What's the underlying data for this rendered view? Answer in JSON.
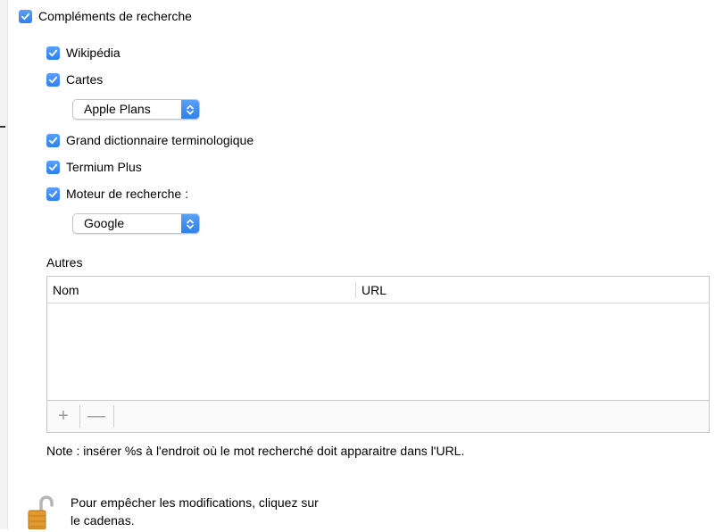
{
  "main_checkbox": {
    "label": "Compléments de recherche",
    "checked": true
  },
  "options": [
    {
      "label": "Wikipédia",
      "checked": true
    },
    {
      "label": "Cartes",
      "checked": true
    },
    {
      "label": "Grand dictionnaire terminologique",
      "checked": true
    },
    {
      "label": "Termium Plus",
      "checked": true
    },
    {
      "label": "Moteur de recherche :",
      "checked": true
    }
  ],
  "maps_popup": {
    "value": "Apple Plans"
  },
  "engine_popup": {
    "value": "Google"
  },
  "others": {
    "label": "Autres",
    "columns": [
      "Nom",
      "URL"
    ],
    "rows": [],
    "add_label": "+",
    "remove_label": "—"
  },
  "note": "Note : insérer %s à l'endroit où le mot recherché doit apparaitre dans l'URL.",
  "lock": {
    "line1": "Pour empêcher les modifications, cliquez sur",
    "line2": "le cadenas."
  },
  "colors": {
    "accent": "#2f80ed"
  }
}
